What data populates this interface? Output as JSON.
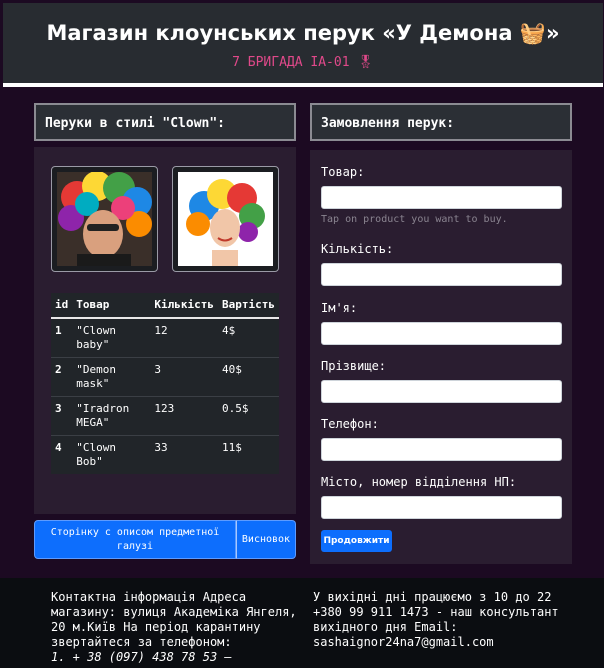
{
  "header": {
    "title": "Магазин клоунських перук «У Демона 🧺»",
    "subtitle": "7 БРИГАДА ІА-01 🎖"
  },
  "left_panel": {
    "title": "Перуки в стилі \"Clown\":",
    "images": [
      {
        "name": "clown-man-photo"
      },
      {
        "name": "clown-woman-photo"
      }
    ],
    "table": {
      "headers": [
        "id",
        "Товар",
        "Кількість",
        "Вартість"
      ],
      "rows": [
        {
          "id": "1",
          "product": "\"Clown baby\"",
          "qty": "12",
          "price": "4$"
        },
        {
          "id": "2",
          "product": "\"Demon mask\"",
          "qty": "3",
          "price": "40$"
        },
        {
          "id": "3",
          "product": "\"Iradron MEGA\"",
          "qty": "123",
          "price": "0.5$"
        },
        {
          "id": "4",
          "product": "\"Clown Bob\"",
          "qty": "33",
          "price": "11$"
        }
      ]
    },
    "buttons": {
      "domain_page": "Сторінку с описом предметної галузі",
      "conclusions": "Висновок"
    }
  },
  "order_form": {
    "title": "Замовлення перук:",
    "product_label": "Товар:",
    "product_value": "",
    "product_hint": "Tap on product you want to buy.",
    "quantity_label": "Кількість:",
    "quantity_value": "",
    "name_label": "Ім'я:",
    "name_value": "",
    "surname_label": "Прізвище:",
    "surname_value": "",
    "phone_label": "Телефон:",
    "phone_value": "",
    "city_label": "Місто, номер відділення НП:",
    "city_value": "",
    "submit_label": "Продовжити"
  },
  "footer": {
    "left_text": "Контактна інформація Адреса магазину: вулиця Академіка Янгеля, 20 м.Київ На період карантину звертайтеся за телефоном:",
    "left_phone": "1. + 38 (097) 438 78 53 —",
    "right_text": "У вихідні дні працюємо з 10 до 22 +380 99 911 1473 - наш консультант вихідного дня Email: sashaignor24na7@gmail.com"
  },
  "colors": {
    "page_bg": "#1c0a22",
    "header_bg": "#282c31",
    "subtitle": "#e0498a",
    "primary_button": "#0d6efd",
    "panel_bg": "#2a1d30",
    "footer_bg": "#0b0d11"
  }
}
